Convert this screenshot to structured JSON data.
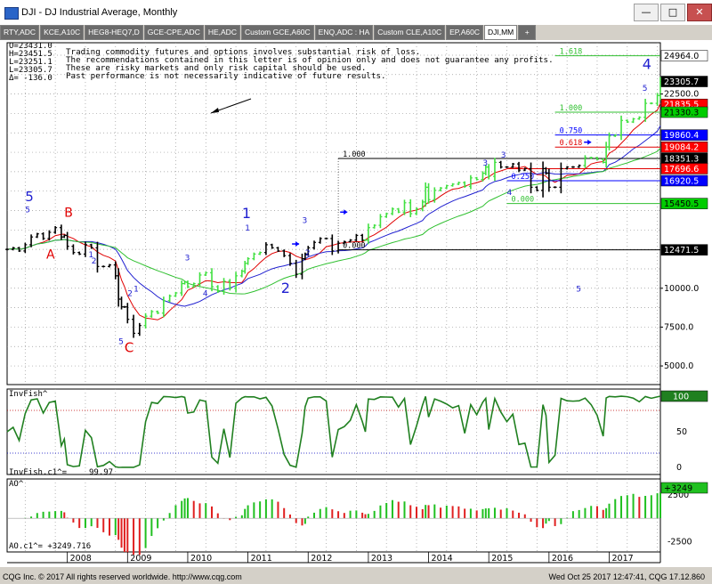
{
  "window": {
    "title": "DJI - DJ Industrial Average, Monthly"
  },
  "tabs": [
    {
      "label": "RTY,ADC"
    },
    {
      "label": "KCE,A10C"
    },
    {
      "label": "HEG8-HEQ7,D"
    },
    {
      "label": "GCE-CPE,ADC"
    },
    {
      "label": "HE,ADC"
    },
    {
      "label": "Custom GCE,A60C"
    },
    {
      "label": "ENQ,ADC : HA"
    },
    {
      "label": "Custom CLE,A10C"
    },
    {
      "label": "EP,A60C"
    },
    {
      "label": "DJI,MM"
    },
    {
      "label": "+"
    }
  ],
  "ohlc": {
    "open": "O=23431.0",
    "high": "H=23451.5",
    "low": "L=23251.1",
    "last": "L=23305.7",
    "change": "Δ= -136.0"
  },
  "disclaimer": [
    "Trading commodity futures and options involves substantial risk of loss.",
    "The recommendations contained in this letter is of opinion only and does not guarantee any profits.",
    "These are risky markets and only risk capital should be used.",
    "Past performance is not necessarily indicative of future results."
  ],
  "chart_data": {
    "type": "candlestick",
    "title": "DJI - DJ Industrial Average, Monthly",
    "x_labels": [
      "2008",
      "2009",
      "2010",
      "2011",
      "2012",
      "2013",
      "2014",
      "2015",
      "2016",
      "2017"
    ],
    "x_range": [
      2007.0,
      2017.85
    ],
    "price_axis": {
      "ylim": [
        3800,
        25800
      ],
      "ticks": [
        5000,
        7500,
        10000,
        12500,
        15000,
        17500,
        20000,
        22500
      ],
      "tick_labels": [
        "5000.0",
        "7500.0",
        "10000.0",
        "12471.5",
        "15450.5",
        "17696.6",
        "19860.4",
        "22500.0"
      ],
      "badges": [
        {
          "label": "24964.0",
          "value": 24964,
          "color": "#ffffff",
          "text": "#000000"
        },
        {
          "label": "23305.7",
          "value": 23305.7,
          "color": "#000000",
          "text": "#ffffff"
        },
        {
          "label": "22500.0",
          "value": 22500,
          "color": "#ffffff",
          "text": "#000000",
          "plain": true
        },
        {
          "label": "21835.5",
          "value": 21835.5,
          "color": "#ff0000",
          "text": "#ffffff"
        },
        {
          "label": "21330.3",
          "value": 21330.3,
          "color": "#00cc00",
          "text": "#000000"
        },
        {
          "label": "19860.4",
          "value": 19860.4,
          "color": "#0000ff",
          "text": "#ffffff"
        },
        {
          "label": "19084.2",
          "value": 19084.2,
          "color": "#ff0000",
          "text": "#ffffff"
        },
        {
          "label": "18351.3",
          "value": 18351.3,
          "color": "#000000",
          "text": "#ffffff"
        },
        {
          "label": "17696.6",
          "value": 17696.6,
          "color": "#ff0000",
          "text": "#ffffff"
        },
        {
          "label": "16920.5",
          "value": 16920.5,
          "color": "#0000ff",
          "text": "#ffffff"
        },
        {
          "label": "15450.5",
          "value": 15450.5,
          "color": "#00cc00",
          "text": "#000000"
        },
        {
          "label": "12471.5",
          "value": 12471.5,
          "color": "#000000",
          "text": "#ffffff"
        },
        {
          "label": "10000.0",
          "value": 10000,
          "plain": true
        },
        {
          "label": "7500.0",
          "value": 7500,
          "plain": true
        },
        {
          "label": "5000.0",
          "value": 5000,
          "plain": true
        }
      ]
    },
    "price_series": [
      [
        2007.0,
        12500
      ],
      [
        2007.1,
        12600
      ],
      [
        2007.2,
        12400
      ],
      [
        2007.3,
        12800
      ],
      [
        2007.4,
        13300
      ],
      [
        2007.5,
        13500
      ],
      [
        2007.6,
        13200
      ],
      [
        2007.7,
        13600
      ],
      [
        2007.8,
        13900
      ],
      [
        2007.9,
        13300
      ],
      [
        2007.95,
        13400
      ],
      [
        2008.0,
        12700
      ],
      [
        2008.1,
        12300
      ],
      [
        2008.2,
        12200
      ],
      [
        2008.3,
        12800
      ],
      [
        2008.4,
        12600
      ],
      [
        2008.5,
        11400
      ],
      [
        2008.6,
        11400
      ],
      [
        2008.7,
        11500
      ],
      [
        2008.8,
        10800
      ],
      [
        2008.85,
        9300
      ],
      [
        2008.9,
        8800
      ],
      [
        2008.95,
        8800
      ],
      [
        2009.0,
        8000
      ],
      [
        2009.1,
        7100
      ],
      [
        2009.2,
        7600
      ],
      [
        2009.3,
        8200
      ],
      [
        2009.4,
        8500
      ],
      [
        2009.5,
        8400
      ],
      [
        2009.6,
        9200
      ],
      [
        2009.7,
        9500
      ],
      [
        2009.8,
        9700
      ],
      [
        2009.9,
        10300
      ],
      [
        2009.95,
        10400
      ],
      [
        2010.0,
        10100
      ],
      [
        2010.1,
        10300
      ],
      [
        2010.2,
        10850
      ],
      [
        2010.3,
        11000
      ],
      [
        2010.4,
        10100
      ],
      [
        2010.5,
        9800
      ],
      [
        2010.6,
        10450
      ],
      [
        2010.7,
        10000
      ],
      [
        2010.8,
        10800
      ],
      [
        2010.9,
        11100
      ],
      [
        2010.95,
        11600
      ],
      [
        2011.0,
        11900
      ],
      [
        2011.1,
        12200
      ],
      [
        2011.2,
        12300
      ],
      [
        2011.3,
        12800
      ],
      [
        2011.4,
        12600
      ],
      [
        2011.5,
        12400
      ],
      [
        2011.6,
        12100
      ],
      [
        2011.7,
        11600
      ],
      [
        2011.8,
        10900
      ],
      [
        2011.9,
        11900
      ],
      [
        2011.95,
        12200
      ],
      [
        2012.0,
        12600
      ],
      [
        2012.1,
        12950
      ],
      [
        2012.2,
        13200
      ],
      [
        2012.3,
        13200
      ],
      [
        2012.4,
        12400
      ],
      [
        2012.5,
        12900
      ],
      [
        2012.6,
        13000
      ],
      [
        2012.7,
        13100
      ],
      [
        2012.8,
        13400
      ],
      [
        2012.9,
        13100
      ],
      [
        2012.95,
        13100
      ],
      [
        2013.0,
        13900
      ],
      [
        2013.1,
        14050
      ],
      [
        2013.2,
        14600
      ],
      [
        2013.3,
        14800
      ],
      [
        2013.4,
        15100
      ],
      [
        2013.5,
        14900
      ],
      [
        2013.6,
        15500
      ],
      [
        2013.7,
        14800
      ],
      [
        2013.8,
        15100
      ],
      [
        2013.9,
        15550
      ],
      [
        2013.95,
        16500
      ],
      [
        2014.0,
        15700
      ],
      [
        2014.1,
        16300
      ],
      [
        2014.2,
        16450
      ],
      [
        2014.3,
        16600
      ],
      [
        2014.4,
        16700
      ],
      [
        2014.5,
        16800
      ],
      [
        2014.6,
        16550
      ],
      [
        2014.7,
        17100
      ],
      [
        2014.8,
        17000
      ],
      [
        2014.9,
        17400
      ],
      [
        2014.95,
        17800
      ],
      [
        2015.0,
        17200
      ],
      [
        2015.1,
        18100
      ],
      [
        2015.2,
        17800
      ],
      [
        2015.3,
        17800
      ],
      [
        2015.4,
        18000
      ],
      [
        2015.5,
        17600
      ],
      [
        2015.6,
        17700
      ],
      [
        2015.7,
        16500
      ],
      [
        2015.8,
        16300
      ],
      [
        2015.9,
        17700
      ],
      [
        2015.95,
        17400
      ],
      [
        2016.0,
        16500
      ],
      [
        2016.1,
        16500
      ],
      [
        2016.2,
        17700
      ],
      [
        2016.3,
        17800
      ],
      [
        2016.4,
        17800
      ],
      [
        2016.5,
        17900
      ],
      [
        2016.6,
        18400
      ],
      [
        2016.7,
        18400
      ],
      [
        2016.8,
        18300
      ],
      [
        2016.9,
        18100
      ],
      [
        2016.95,
        19100
      ],
      [
        2017.0,
        19800
      ],
      [
        2017.1,
        19850
      ],
      [
        2017.2,
        20800
      ],
      [
        2017.3,
        20700
      ],
      [
        2017.4,
        20900
      ],
      [
        2017.5,
        21000
      ],
      [
        2017.6,
        21900
      ],
      [
        2017.7,
        21900
      ],
      [
        2017.8,
        22400
      ],
      [
        2017.85,
        23300
      ]
    ],
    "invfish": {
      "label": "InvFish^",
      "readout": "InvFish.c1^=",
      "readout_value": "99.97",
      "ylim": [
        -10,
        110
      ],
      "ticks": [
        0,
        50,
        100
      ],
      "tick_labels": [
        "0",
        "50",
        "100"
      ],
      "badge": "100"
    },
    "ao": {
      "label": "AO^",
      "readout": "AO.c1^= +3249.716",
      "ylim": [
        -3600,
        4200
      ],
      "ticks": [
        -2500,
        0,
        2500
      ],
      "tick_labels": [
        "-2500",
        "",
        "2500"
      ],
      "badge": "+3249"
    },
    "fib_labels": [
      "1.000",
      "0.000",
      "1.618",
      "1.000",
      "0.750",
      "0.618",
      "0.250",
      "0.000"
    ],
    "wave_labels": [
      "5",
      "5",
      "A",
      "B",
      "C",
      "1",
      "1",
      "2",
      "2",
      "3",
      "3",
      "4",
      "4",
      "5",
      "5",
      "1",
      "2",
      "1",
      "2",
      "3",
      "4",
      "5",
      "3"
    ]
  },
  "status": {
    "left": "CQG Inc. © 2017 All rights reserved worldwide. http://www.cqg.com",
    "right": "Wed Oct 25 2017 12:47:41, CQG 17.12.860"
  }
}
